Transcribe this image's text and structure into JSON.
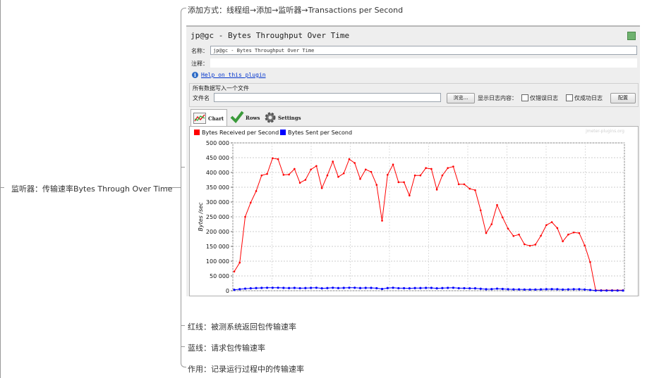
{
  "mindmap": {
    "root": "监听器：传输速率Bytes Through Over Time",
    "add_method": "添加方式：线程组→添加→监听器→Transactions per Second",
    "red_line": "红线：被测系统返回包传输速率",
    "blue_line": "蓝线：请求包传输速率",
    "purpose": "作用：记录运行过程中的传输速率"
  },
  "panel": {
    "title": "jp@gc - Bytes Throughput Over Time",
    "name_label": "名称：",
    "name_value": "jp@gc - Bytes Throughput Over Time",
    "comment_label": "注释：",
    "help_link": "Help on this plugin",
    "file_group_title": "所有数据写入一个文件",
    "filename_label": "文件名",
    "browse_button": "浏览...",
    "log_content_label": "显示日志内容：",
    "errors_only_label": "仅错误日志",
    "success_only_label": "仅成功日志",
    "configure_button": "配置",
    "tabs": [
      "Chart",
      "Rows",
      "Settings"
    ],
    "watermark": "jmeter-plugins.org"
  },
  "chart_data": {
    "type": "line",
    "ylabel": "Bytes /sec",
    "ylim": [
      0,
      500000
    ],
    "yticks": [
      "0",
      "50 000",
      "100 000",
      "150 000",
      "200 000",
      "250 000",
      "300 000",
      "350 000",
      "400 000",
      "450 000",
      "500 000"
    ],
    "grid": true,
    "legend": "top-left",
    "series": [
      {
        "name": "Bytes Received per Second",
        "color": "#ff0000",
        "values": [
          65000,
          95000,
          250000,
          298000,
          337000,
          390000,
          395000,
          448000,
          445000,
          392000,
          393000,
          412000,
          365000,
          375000,
          410000,
          422000,
          347000,
          390000,
          437000,
          385000,
          397000,
          445000,
          432000,
          378000,
          410000,
          402000,
          358000,
          237000,
          392000,
          427000,
          367000,
          367000,
          322000,
          390000,
          390000,
          415000,
          412000,
          342000,
          390000,
          415000,
          420000,
          360000,
          360000,
          345000,
          340000,
          272000,
          195000,
          225000,
          290000,
          248000,
          210000,
          185000,
          190000,
          157000,
          152000,
          156000,
          186000,
          222000,
          232000,
          212000,
          167000,
          190000,
          197000,
          195000,
          153000,
          97000,
          2000,
          2000,
          2000,
          2000,
          2000,
          2000
        ]
      },
      {
        "name": "Bytes Sent per Second",
        "color": "#0000ff",
        "values": [
          3000,
          5000,
          7000,
          8000,
          9000,
          9500,
          10000,
          10000,
          10000,
          9500,
          9000,
          9500,
          8500,
          9000,
          9500,
          10000,
          8000,
          9000,
          10000,
          9000,
          9500,
          10000,
          10000,
          9000,
          9500,
          9500,
          8500,
          6000,
          9000,
          10000,
          8500,
          8500,
          8000,
          9000,
          9000,
          9500,
          9500,
          8000,
          9000,
          9500,
          10000,
          8500,
          8500,
          8000,
          8000,
          6500,
          5000,
          5500,
          7000,
          6000,
          5000,
          4500,
          4500,
          4000,
          4000,
          4000,
          4500,
          5000,
          5500,
          5000,
          4000,
          4500,
          5000,
          5000,
          4000,
          2500,
          500,
          500,
          500,
          500,
          500,
          500
        ]
      }
    ]
  }
}
